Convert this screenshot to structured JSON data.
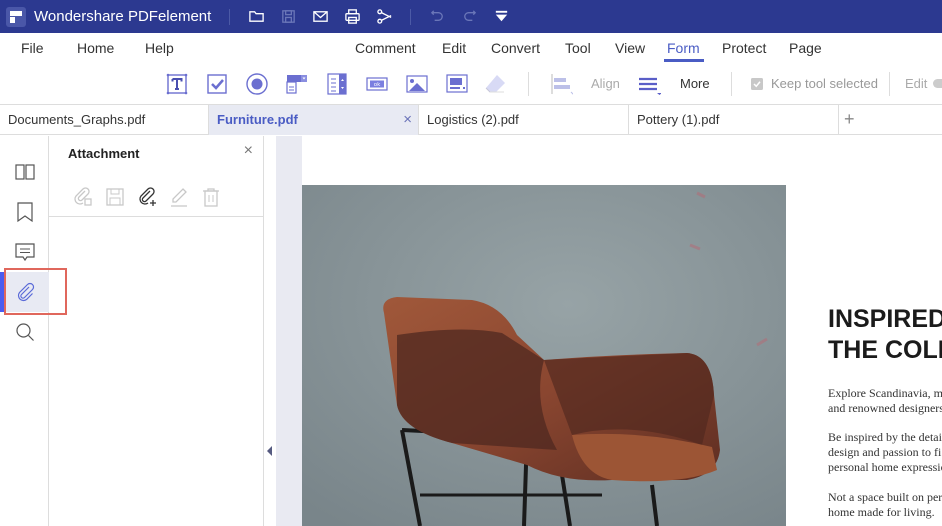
{
  "app": {
    "title": "Wondershare PDFelement"
  },
  "titlebar_icons": [
    "folder-open-icon",
    "save-icon",
    "mail-icon",
    "print-icon",
    "share-icon",
    "undo-icon",
    "redo-icon",
    "quick-access-dropdown-icon"
  ],
  "menu": {
    "items": [
      {
        "label": "File"
      },
      {
        "label": "Home"
      },
      {
        "label": "Help"
      },
      {
        "label": "Comment"
      },
      {
        "label": "Edit"
      },
      {
        "label": "Convert"
      },
      {
        "label": "Tool"
      },
      {
        "label": "View"
      },
      {
        "label": "Form",
        "active": true
      },
      {
        "label": "Protect"
      },
      {
        "label": "Page"
      }
    ]
  },
  "toolbar": {
    "tools": [
      "text-field-icon",
      "checkbox-icon",
      "radio-button-icon",
      "combo-box-icon",
      "list-box-icon",
      "button-icon",
      "image-field-icon",
      "signature-field-icon",
      "eraser-icon"
    ],
    "align_label": "Align",
    "more_label": "More",
    "keep_tool_label": "Keep tool selected",
    "keep_tool_checked": true,
    "edit_label": "Edit"
  },
  "tabs": [
    {
      "label": "Documents_Graphs.pdf",
      "active": false
    },
    {
      "label": "Furniture.pdf",
      "active": true
    },
    {
      "label": "Logistics (2).pdf",
      "active": false
    },
    {
      "label": "Pottery (1).pdf",
      "active": false
    }
  ],
  "tab_close_glyph": "×",
  "tab_add_glyph": "+",
  "sidebar": {
    "items": [
      {
        "name": "thumbnails",
        "icon": "thumbnails-icon"
      },
      {
        "name": "bookmarks",
        "icon": "bookmark-icon"
      },
      {
        "name": "comments",
        "icon": "comment-icon"
      },
      {
        "name": "attachments",
        "icon": "paperclip-icon",
        "active": true
      },
      {
        "name": "search",
        "icon": "search-icon"
      }
    ]
  },
  "panel": {
    "title": "Attachment",
    "close_glyph": "×",
    "tools": [
      "open-attachment-icon",
      "save-attachment-icon",
      "add-attachment-icon",
      "edit-attachment-icon",
      "delete-attachment-icon"
    ]
  },
  "document": {
    "heading_lines": [
      "INSPIRED",
      "THE COLL"
    ],
    "paragraphs": [
      [
        "Explore Scandinavia, m",
        "and renowned designers"
      ],
      [
        "Be inspired by the detai",
        "design and passion to fi",
        "personal home expressio"
      ],
      [
        "Not a space built on per",
        "home made for living."
      ]
    ]
  },
  "colors": {
    "titlebar": "#2c3990",
    "accent": "#4a5cc4",
    "highlight_box": "#e0675c"
  }
}
